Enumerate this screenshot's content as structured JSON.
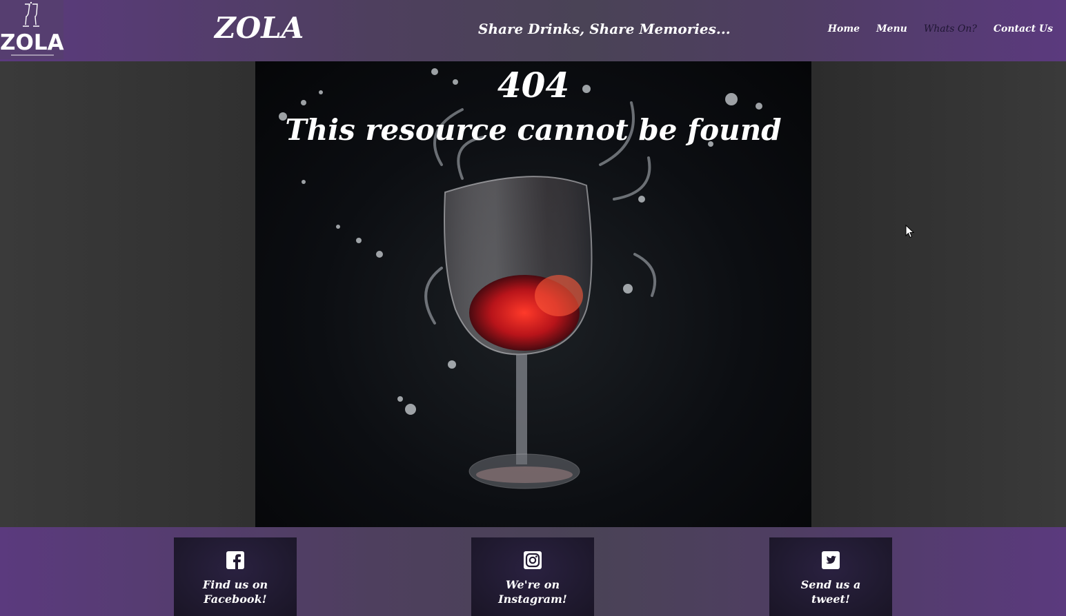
{
  "header": {
    "logo_text": "ZOLA",
    "brand": "ZOLA",
    "tagline": "Share Drinks, Share Memories...",
    "nav": [
      {
        "label": "Home",
        "active": false
      },
      {
        "label": "Menu",
        "active": false
      },
      {
        "label": "Whats On?",
        "active": true
      },
      {
        "label": "Contact Us",
        "active": false
      }
    ]
  },
  "main": {
    "error_code": "404",
    "error_message": "This resource cannot be found",
    "hero_image": "wine-glass-splash"
  },
  "footer": {
    "cards": [
      {
        "icon": "facebook-icon",
        "line1": "Find us on",
        "line2": "Facebook!"
      },
      {
        "icon": "instagram-icon",
        "line1": "We're on",
        "line2": "Instagram!"
      },
      {
        "icon": "twitter-icon",
        "line1": "Send us a",
        "line2": "tweet!"
      }
    ]
  },
  "colors": {
    "header_purple": "#5b3a7e",
    "card_dark": "#201a30",
    "text": "#ffffff"
  }
}
